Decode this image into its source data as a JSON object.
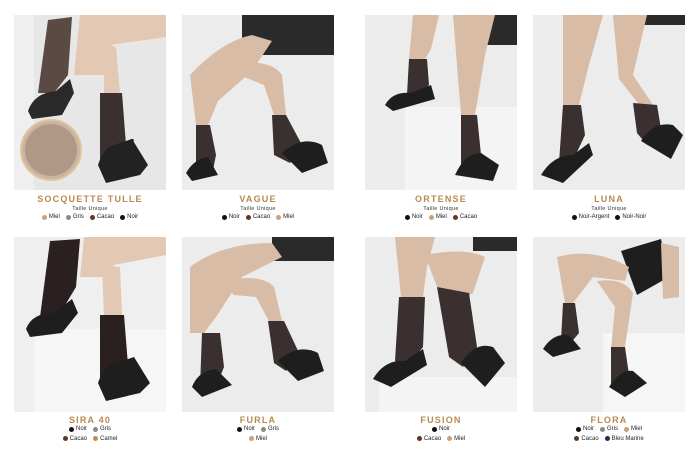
{
  "products": [
    {
      "id": "socouette",
      "name": "SOCQUETTE TULLE",
      "size": "Taille Unique",
      "color_rows": [
        [
          {
            "label": "Miel",
            "color": "#c9a27a"
          },
          {
            "label": "Gris",
            "color": "#8a8a8a"
          },
          {
            "label": "Cacao",
            "color": "#5b3a24"
          },
          {
            "label": "Noir",
            "color": "#111111"
          }
        ]
      ]
    },
    {
      "id": "vague",
      "name": "VAGUE",
      "size": "Taille Unique",
      "color_rows": [
        [
          {
            "label": "Noir",
            "color": "#111111"
          },
          {
            "label": "Cacao",
            "color": "#5b3a24"
          },
          {
            "label": "Miel",
            "color": "#c9a27a"
          }
        ]
      ]
    },
    {
      "id": "ortense",
      "name": "ORTENSE",
      "size": "Taille Unique",
      "color_rows": [
        [
          {
            "label": "Noir",
            "color": "#111111"
          },
          {
            "label": "Miel",
            "color": "#c9a27a"
          },
          {
            "label": "Cacao",
            "color": "#5b3a24"
          }
        ]
      ]
    },
    {
      "id": "luna",
      "name": "LUNA",
      "size": "Taille Unique",
      "color_rows": [
        [
          {
            "label": "Noir-Argent",
            "color": "#111111"
          },
          {
            "label": "Noir-Noir",
            "color": "#111111"
          }
        ]
      ]
    },
    {
      "id": "sira",
      "name": "SIRA 40",
      "size": "",
      "color_rows": [
        [
          {
            "label": "Noir",
            "color": "#111111"
          },
          {
            "label": "Gris",
            "color": "#8a8a8a"
          }
        ],
        [
          {
            "label": "Cacao",
            "color": "#5b3a24"
          },
          {
            "label": "Camel",
            "color": "#c08a52"
          }
        ]
      ]
    },
    {
      "id": "furla",
      "name": "FURLA",
      "size": "",
      "color_rows": [
        [
          {
            "label": "Noir",
            "color": "#111111"
          },
          {
            "label": "Gris",
            "color": "#8a8a8a"
          }
        ],
        [
          {
            "label": "Miel",
            "color": "#c9a27a"
          }
        ]
      ]
    },
    {
      "id": "fusion",
      "name": "FUSION",
      "size": "",
      "color_rows": [
        [
          {
            "label": "Noir",
            "color": "#111111"
          }
        ],
        [
          {
            "label": "Cacao",
            "color": "#5b3a24"
          },
          {
            "label": "Miel",
            "color": "#c9a27a"
          }
        ]
      ]
    },
    {
      "id": "flora",
      "name": "FLORA",
      "size": "",
      "color_rows": [
        [
          {
            "label": "Noir",
            "color": "#111111"
          },
          {
            "label": "Gris",
            "color": "#8a8a8a"
          },
          {
            "label": "Miel",
            "color": "#c9a27a"
          }
        ],
        [
          {
            "label": "Cacao",
            "color": "#5b3a24"
          },
          {
            "label": "Bleu Marine",
            "color": "#1f2f5a"
          }
        ]
      ]
    }
  ]
}
